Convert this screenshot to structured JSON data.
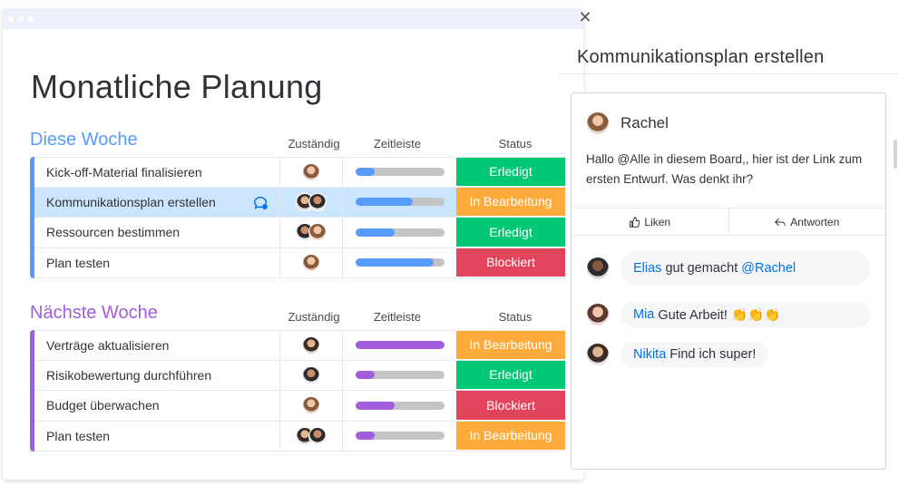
{
  "board": {
    "title": "Monatliche Planung",
    "columns": {
      "owner": "Zuständig",
      "timeline": "Zeitleiste",
      "status": "Status"
    },
    "groups": [
      {
        "name": "Diese Woche",
        "color": "#579bfc",
        "bar_color": "#579bfc",
        "items": [
          {
            "name": "Kick-off-Material finalisieren",
            "avatars": [
              "person-avatar-1"
            ],
            "progress": 0.22,
            "status": "Erledigt",
            "status_color": "#00c875"
          },
          {
            "name": "Kommunikationsplan erstellen",
            "avatars": [
              "person-avatar-2",
              "person-avatar-3"
            ],
            "progress": 0.65,
            "status": "In Bearbeitung",
            "status_color": "#fdab3d",
            "selected": true
          },
          {
            "name": "Ressourcen bestimmen",
            "avatars": [
              "person-avatar-4",
              "person-avatar-5"
            ],
            "progress": 0.44,
            "status": "Erledigt",
            "status_color": "#00c875"
          },
          {
            "name": "Plan testen",
            "avatars": [
              "person-avatar-6"
            ],
            "progress": 0.88,
            "status": "Blockiert",
            "status_color": "#e2445c"
          }
        ]
      },
      {
        "name": "Nächste Woche",
        "color": "#a25ddc",
        "bar_color": "#a25ddc",
        "items": [
          {
            "name": "Verträge aktualisieren",
            "avatars": [
              "person-avatar-7"
            ],
            "progress": 1.0,
            "status": "In Bearbeitung",
            "status_color": "#fdab3d"
          },
          {
            "name": "Risikobewertung durchführen",
            "avatars": [
              "person-avatar-8"
            ],
            "progress": 0.22,
            "status": "Erledigt",
            "status_color": "#00c875"
          },
          {
            "name": "Budget überwachen",
            "avatars": [
              "person-avatar-9"
            ],
            "progress": 0.44,
            "status": "Blockiert",
            "status_color": "#e2445c"
          },
          {
            "name": "Plan testen",
            "avatars": [
              "person-avatar-10",
              "person-avatar-11"
            ],
            "progress": 0.22,
            "status": "In Bearbeitung",
            "status_color": "#fdab3d"
          }
        ]
      }
    ]
  },
  "panel": {
    "title": "Kommunikationsplan erstellen",
    "post": {
      "author": "Rachel",
      "text": "Hallo @Alle in diesem Board,, hier ist der Link zum ersten Entwurf. Was denkt ihr?"
    },
    "actions": {
      "like": "Liken",
      "reply": "Antworten"
    },
    "replies": [
      {
        "author": "Elias",
        "text": "gut gemacht",
        "mention": "@Rachel"
      },
      {
        "author": "Mia",
        "text": "Gute Arbeit! 👏👏👏",
        "mention": ""
      },
      {
        "author": "Nikita",
        "text": "Find ich super!",
        "mention": ""
      }
    ]
  }
}
